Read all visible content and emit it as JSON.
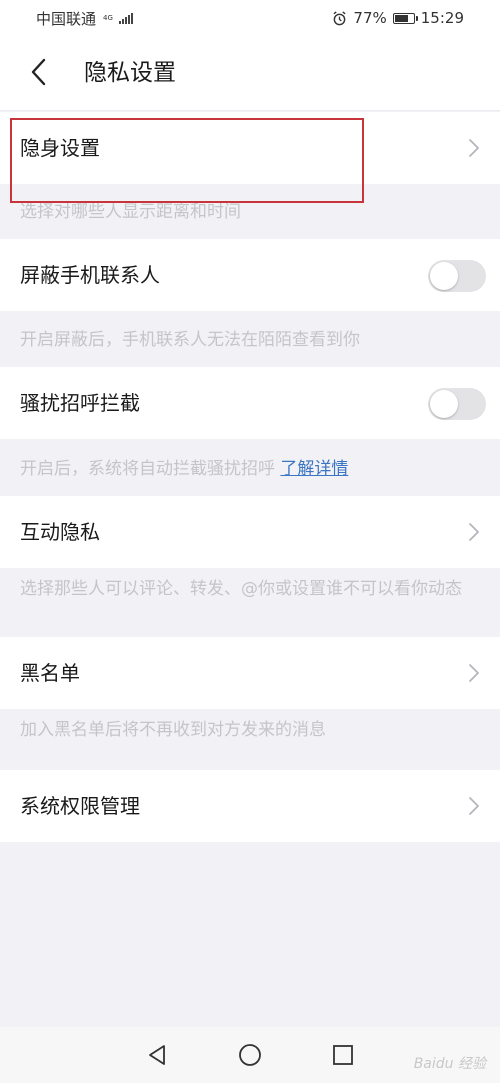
{
  "status_bar": {
    "carrier": "中国联通",
    "network": "4G",
    "battery_percent": "77%",
    "battery_level": 0.77,
    "time": "15:29",
    "icons": [
      "signal-icon",
      "alarm-icon",
      "battery-icon"
    ]
  },
  "header": {
    "title": "隐私设置",
    "back_icon": "chevron-left-icon"
  },
  "settings": {
    "stealth": {
      "label": "隐身设置",
      "hint": "选择对哪些人显示距离和时间"
    },
    "block_contacts": {
      "label": "屏蔽手机联系人",
      "hint": "开启屏蔽后，手机联系人无法在陌陌查看到你",
      "enabled": false
    },
    "harassment_block": {
      "label": "骚扰招呼拦截",
      "hint": "开启后，系统将自动拦截骚扰招呼",
      "hint_link": "了解详情",
      "enabled": false
    },
    "interaction_privacy": {
      "label": "互动隐私",
      "hint": "选择那些人可以评论、转发、@你或设置谁不可以看你动态"
    },
    "blacklist": {
      "label": "黑名单",
      "hint": "加入黑名单后将不再收到对方发来的消息"
    },
    "system_permissions": {
      "label": "系统权限管理"
    }
  },
  "watermark": "Baidu 经验",
  "colors": {
    "background": "#f2f2f6",
    "card": "#ffffff",
    "highlight": "#c8343c",
    "link": "#3a75c4",
    "hint_text": "#c4c4ca",
    "toggle_off": "#e3e3e6"
  }
}
